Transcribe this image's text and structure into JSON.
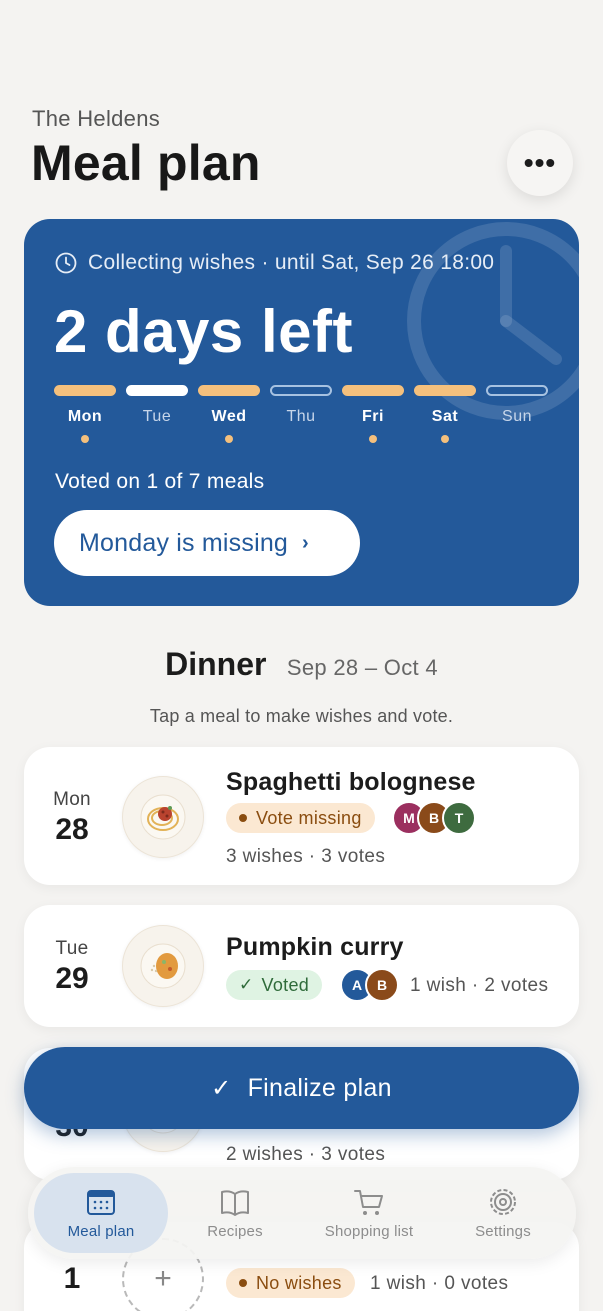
{
  "header": {
    "household": "The Heldens",
    "title": "Meal plan",
    "more_icon": "ellipsis-icon",
    "more_label": "•••"
  },
  "status_card": {
    "collecting": "Collecting wishes · until Sat, Sep 26 18:00",
    "days_left": "2 days left",
    "voted_summary": "Voted on 1 of 7 meals",
    "missing_button": "Monday is missing",
    "chevron": "›",
    "days": [
      {
        "label": "Mon",
        "state": "voted"
      },
      {
        "label": "Tue",
        "state": "current"
      },
      {
        "label": "Wed",
        "state": "voted"
      },
      {
        "label": "Thu",
        "state": "open"
      },
      {
        "label": "Fri",
        "state": "voted"
      },
      {
        "label": "Sat",
        "state": "voted"
      },
      {
        "label": "Sun",
        "state": "open"
      }
    ]
  },
  "dinner": {
    "title": "Dinner",
    "range": "Sep 28 – Oct 4",
    "hint": "Tap a meal to make wishes and vote."
  },
  "meals": [
    {
      "dow": "Mon",
      "day": "28",
      "name": "Spaghetti bolognese",
      "status": "Vote missing",
      "stats": "3 wishes · 3 votes",
      "avatars": [
        {
          "initial": "M",
          "color": "#9b2f5f"
        },
        {
          "initial": "B",
          "color": "#8a4a1a"
        },
        {
          "initial": "T",
          "color": "#3e6b3f"
        }
      ]
    },
    {
      "dow": "Tue",
      "day": "29",
      "name": "Pumpkin curry",
      "status": "Voted",
      "stats": "1 wish · 2 votes",
      "avatars": [
        {
          "initial": "A",
          "color": "#23599a"
        },
        {
          "initial": "B",
          "color": "#8a4a1a"
        }
      ]
    },
    {
      "dow": "",
      "day": "30",
      "name": "",
      "status": "",
      "stats": "2 wishes · 3 votes",
      "avatars": []
    },
    {
      "dow": "",
      "day": "1",
      "name": "",
      "status": "No wishes",
      "stats": "1 wish · 0 votes",
      "avatars": []
    }
  ],
  "finalize": {
    "label": "Finalize plan",
    "check": "✓"
  },
  "tabs": [
    {
      "label": "Meal plan",
      "icon": "calendar-icon",
      "active": true
    },
    {
      "label": "Recipes",
      "icon": "book-icon",
      "active": false
    },
    {
      "label": "Shopping list",
      "icon": "cart-icon",
      "active": false
    },
    {
      "label": "Settings",
      "icon": "gear-icon",
      "active": false
    }
  ],
  "colors": {
    "primary": "#23599a",
    "accent_voted": "#f4c07d",
    "badge_missing_bg": "#fbe8d2",
    "badge_voted_bg": "#dff3e3",
    "background": "#f4f3f1"
  }
}
